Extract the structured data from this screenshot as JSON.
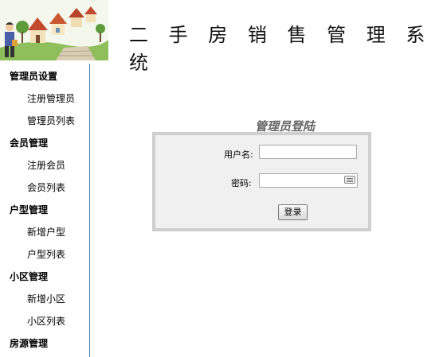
{
  "header": {
    "title": "二 手 房 销 售 管 理 系 统"
  },
  "sidebar": {
    "groups": [
      {
        "label": "管理员设置",
        "items": [
          "注册管理员",
          "管理员列表"
        ]
      },
      {
        "label": "会员管理",
        "items": [
          "注册会员",
          "会员列表"
        ]
      },
      {
        "label": "户型管理",
        "items": [
          "新增户型",
          "户型列表"
        ]
      },
      {
        "label": "小区管理",
        "items": [
          "新增小区",
          "小区列表"
        ]
      },
      {
        "label": "房源管理",
        "items": []
      }
    ]
  },
  "login": {
    "title": "管理员登陆",
    "username_label": "用户名:",
    "username_value": "",
    "password_label": "密码:",
    "password_value": "",
    "submit_label": "登录"
  }
}
